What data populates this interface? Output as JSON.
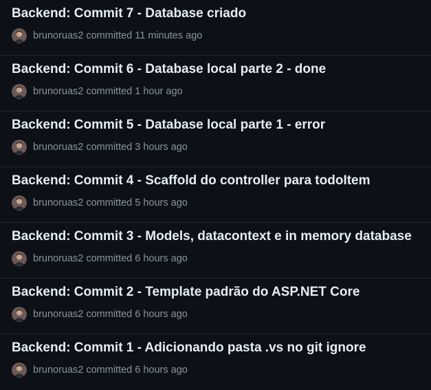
{
  "commits": [
    {
      "title": "Backend: Commit 7 - Database criado",
      "author": "brunoruas2",
      "verb": "committed",
      "time": "11 minutes ago"
    },
    {
      "title": "Backend: Commit 6 - Database local parte 2 - done",
      "author": "brunoruas2",
      "verb": "committed",
      "time": "1 hour ago"
    },
    {
      "title": "Backend: Commit 5 - Database local parte 1 - error",
      "author": "brunoruas2",
      "verb": "committed",
      "time": "3 hours ago"
    },
    {
      "title": "Backend: Commit 4 - Scaffold do controller para todoItem",
      "author": "brunoruas2",
      "verb": "committed",
      "time": "5 hours ago"
    },
    {
      "title": "Backend: Commit 3 - Models, datacontext e in memory database",
      "author": "brunoruas2",
      "verb": "committed",
      "time": "6 hours ago"
    },
    {
      "title": "Backend: Commit 2 - Template padrão do ASP.NET Core",
      "author": "brunoruas2",
      "verb": "committed",
      "time": "6 hours ago"
    },
    {
      "title": "Backend: Commit 1 - Adicionando pasta .vs no git ignore",
      "author": "brunoruas2",
      "verb": "committed",
      "time": "6 hours ago"
    }
  ],
  "colors": {
    "background": "#0d1117",
    "title": "#e6edf3",
    "muted": "#8b949e",
    "divider": "#21262d"
  },
  "icons": {
    "avatar": "user-avatar-icon"
  }
}
